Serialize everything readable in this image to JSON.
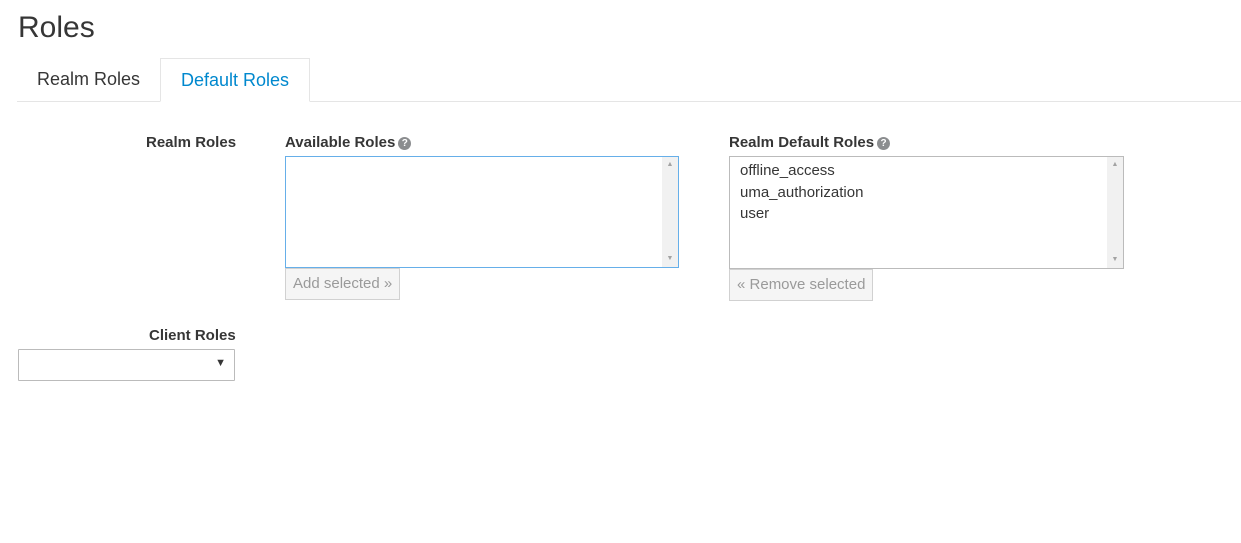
{
  "page": {
    "title": "Roles"
  },
  "tabs": [
    {
      "label": "Realm Roles",
      "active": false
    },
    {
      "label": "Default Roles",
      "active": true
    }
  ],
  "realm_roles": {
    "section_label": "Realm Roles",
    "available": {
      "label": "Available Roles",
      "help_icon": "question-circle-icon",
      "items": [],
      "button_label": "Add selected",
      "button_icon": "double-chevron-right-icon",
      "button_glyph": "»"
    },
    "defaults": {
      "label": "Realm Default Roles",
      "help_icon": "question-circle-icon",
      "items": [
        "offline_access",
        "uma_authorization",
        "user"
      ],
      "button_label": "Remove selected",
      "button_icon": "double-chevron-left-icon",
      "button_glyph": "«"
    }
  },
  "client_roles": {
    "label": "Client Roles",
    "selected_value": "",
    "caret_icon": "caret-down-icon"
  },
  "colors": {
    "active_tab": "#0088ce",
    "focus_border": "#66afe9",
    "disabled_text": "#9a9a9a"
  }
}
